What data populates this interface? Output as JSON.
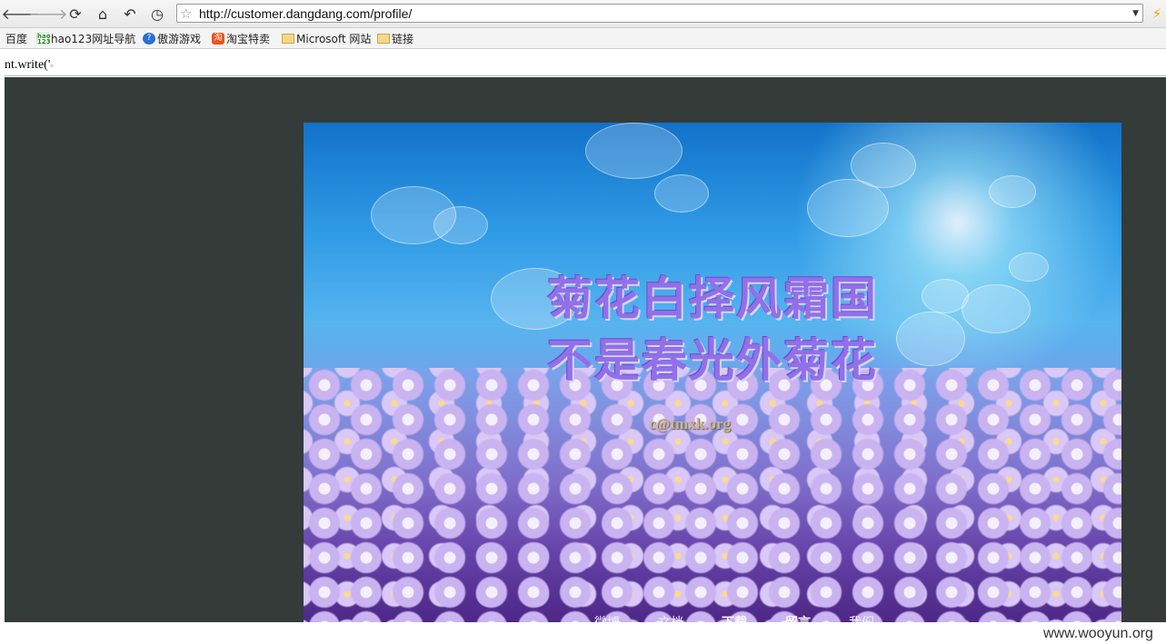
{
  "toolbar": {
    "back_icon": "back-arrow",
    "forward_icon": "forward-arrow",
    "reload_icon": "reload",
    "home_icon": "home",
    "undo_icon": "undo",
    "history_icon": "clock",
    "url": "http://customer.dangdang.com/profile/",
    "bolt_icon": "lightning"
  },
  "bookmarks": [
    {
      "label": "百度"
    },
    {
      "label": "hao123网址导航",
      "icon": "hao123"
    },
    {
      "label": "傲游游戏",
      "icon": "aoyou"
    },
    {
      "label": "淘宝特卖",
      "icon": "taobao"
    },
    {
      "label": "Microsoft 网站",
      "icon": "folder"
    },
    {
      "label": "链接",
      "icon": "folder"
    }
  ],
  "page": {
    "script_text": "nt.write('",
    "script_cut": "▫",
    "banner": {
      "poem_line1": "菊花白择风霜国",
      "poem_line2": "不是春光外菊花",
      "email": "c@tmxk.org",
      "nav": [
        "微博",
        "文档",
        "下载",
        "留言",
        "我们"
      ]
    }
  },
  "watermark": "www.wooyun.org",
  "colors": {
    "panel_bg": "#343b39",
    "poem": "#9170e8"
  }
}
